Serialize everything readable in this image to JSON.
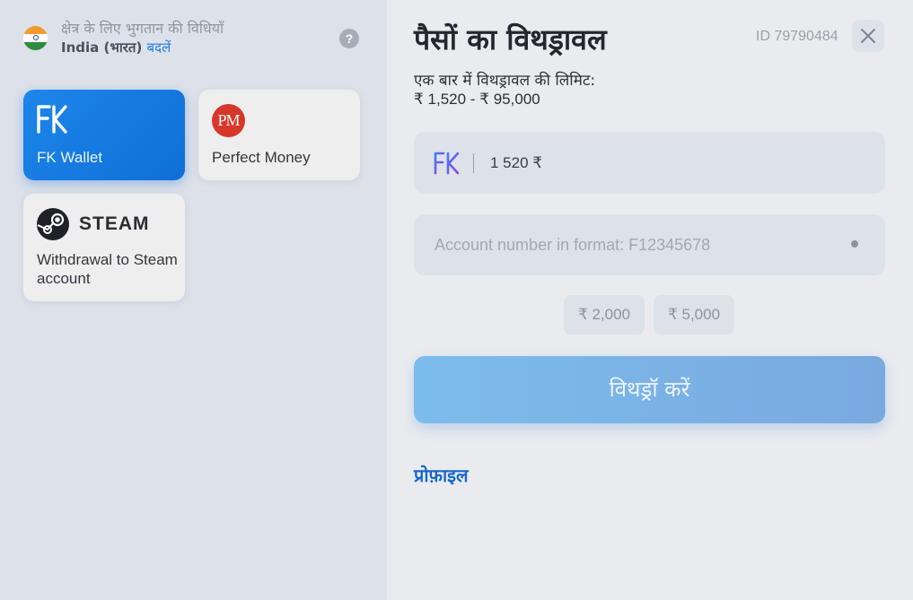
{
  "region": {
    "title": "क्षेत्र के लिए भुगतान की विधियाँ",
    "country": "India (भारत)",
    "change_label": "बदलें",
    "help_label": "?"
  },
  "methods": [
    {
      "label": "FK Wallet",
      "logo_text": "FK",
      "selected": true
    },
    {
      "label": "Perfect Money",
      "logo_text": "PM",
      "selected": false
    },
    {
      "label": "Withdrawal to Steam account",
      "logo_text": "STEAM",
      "selected": false
    }
  ],
  "withdrawal": {
    "title": "पैसों का विथड्रावल",
    "user_id": "ID 79790484",
    "limit_label": "एक बार में विथड्रावल की लिमिट:",
    "limit_range": "₹ 1,520 - ₹ 95,000",
    "amount_value": "1 520 ₹",
    "account_placeholder": "Account number in format: F12345678",
    "quick_amounts": [
      "₹ 2,000",
      "₹ 5,000"
    ],
    "submit_label": "विथड्रॉ करें",
    "profile_link": "प्रोफ़ाइल"
  },
  "colors": {
    "accent": "#1e7be8",
    "selected_card": "#1479e0",
    "button": "#7cb4e8",
    "pm_red": "#d6372a"
  }
}
